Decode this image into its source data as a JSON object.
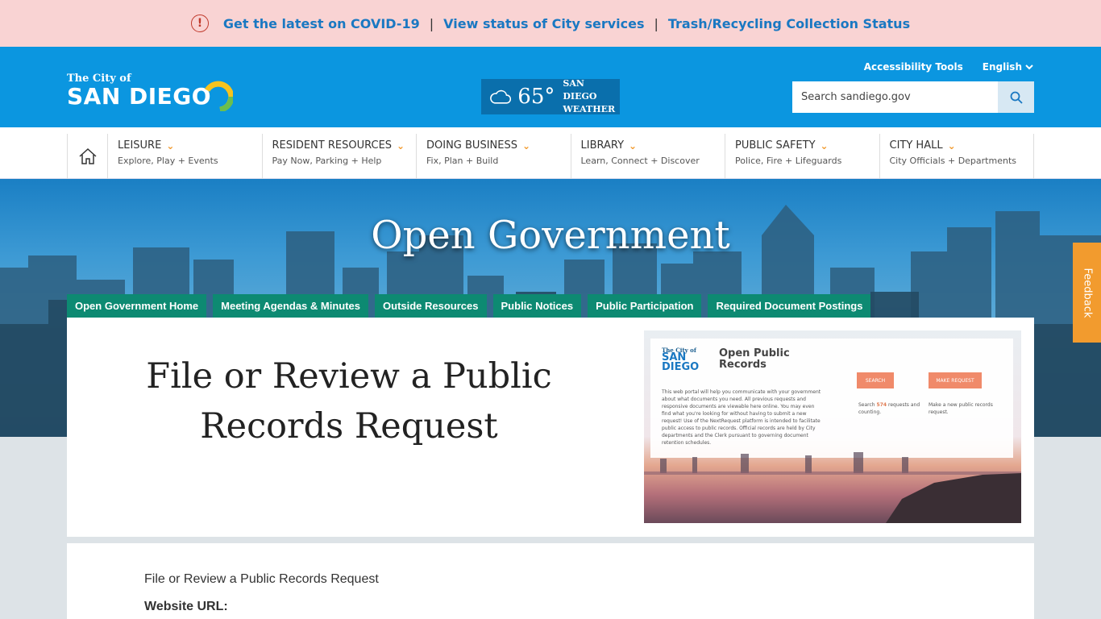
{
  "alert": {
    "links": [
      "Get the latest on COVID-19",
      "View status of City services",
      "Trash/Recycling Collection Status"
    ],
    "separator": "|"
  },
  "logo": {
    "line1": "The City of",
    "line2": "SAN DIEGO"
  },
  "weather": {
    "temp": "65°",
    "label_line1": "SAN DIEGO",
    "label_line2": "WEATHER"
  },
  "utility": {
    "accessibility": "Accessibility Tools",
    "language": "English"
  },
  "search": {
    "placeholder": "Search sandiego.gov"
  },
  "nav": {
    "items": [
      {
        "title": "LEISURE",
        "sub": "Explore, Play + Events"
      },
      {
        "title": "RESIDENT RESOURCES",
        "sub": "Pay Now, Parking + Help"
      },
      {
        "title": "DOING BUSINESS",
        "sub": "Fix, Plan + Build"
      },
      {
        "title": "LIBRARY",
        "sub": "Learn, Connect + Discover"
      },
      {
        "title": "PUBLIC SAFETY",
        "sub": "Police, Fire + Lifeguards"
      },
      {
        "title": "CITY HALL",
        "sub": "City Officials + Departments"
      }
    ]
  },
  "hero": {
    "title": "Open Government"
  },
  "subtabs": [
    "Open Government Home",
    "Meeting Agendas & Minutes",
    "Outside Resources",
    "Public Notices",
    "Public Participation",
    "Required Document Postings"
  ],
  "panel": {
    "title": "File or Review a Public Records Request",
    "thumbnail": {
      "logo_small": "The City of",
      "logo_big_1": "SAN",
      "logo_big_2": "DIEGO",
      "title": "Open Public Records",
      "body": "This web portal will help you communicate with your government about what documents you need. All previous requests and responsive documents are viewable here online. You may even find what you're looking for without having to submit a new request! Use of the NextRequest platform is intended to facilitate public access to public records. Official records are held by City departments and the Clerk pursuant to governing document retention schedules.",
      "search_btn": "SEARCH",
      "make_btn": "MAKE REQUEST",
      "search_note_pre": "Search",
      "search_count": "574",
      "search_note_post": "requests and counting.",
      "make_note": "Make a new public records request."
    }
  },
  "content": {
    "breadcrumb": "File or Review a Public Records Request",
    "url_label": "Website URL:"
  },
  "feedback": "Feedback",
  "colors": {
    "header_blue": "#0b96e0",
    "tab_green": "#0d8a72",
    "accent_orange": "#f29b2e",
    "alert_pink": "#f9d3d3",
    "link_blue": "#1a78c2"
  }
}
